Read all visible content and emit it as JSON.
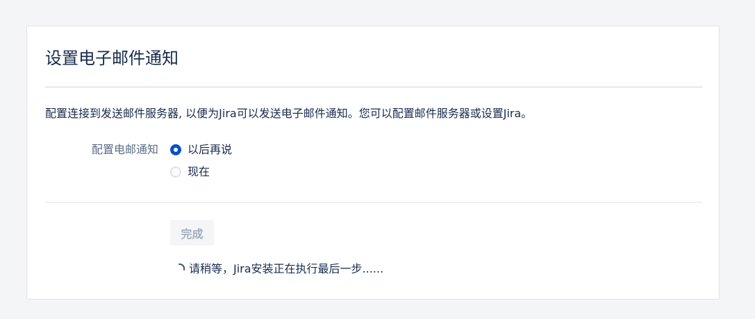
{
  "page": {
    "title": "设置电子邮件通知",
    "description": "配置连接到发送邮件服务器, 以便为Jira可以发送电子邮件通知。您可以配置邮件服务器或设置Jira。"
  },
  "form": {
    "field_label": "配置电邮通知",
    "options": [
      {
        "label": "以后再说",
        "selected": true
      },
      {
        "label": "现在",
        "selected": false
      }
    ]
  },
  "actions": {
    "finish_label": "完成",
    "finish_disabled": true
  },
  "status": {
    "progress_text": "请稍等，Jira安装正在执行最后一步......"
  },
  "colors": {
    "accent": "#0052cc",
    "background": "#f4f5f7",
    "panel": "#ffffff",
    "text": "#172b4d",
    "label": "#5e6c84"
  }
}
